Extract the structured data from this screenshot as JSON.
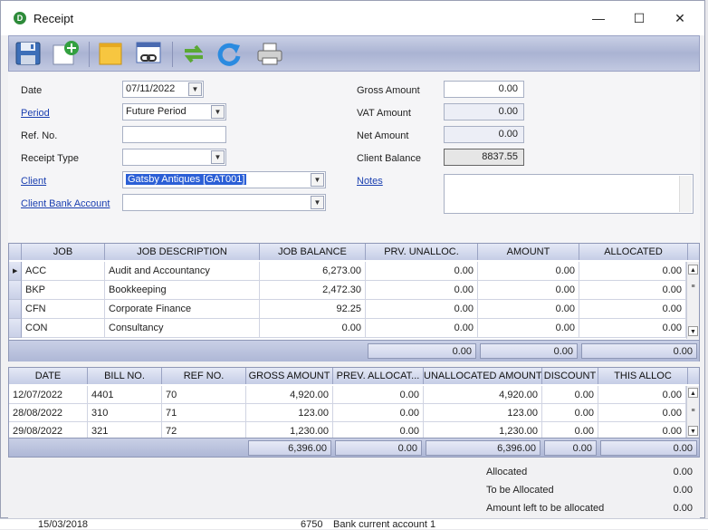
{
  "window": {
    "title": "Receipt",
    "minimize": "—",
    "maximize": "☐",
    "close": "✕"
  },
  "toolbar": {
    "icons": [
      "save-icon",
      "new-icon",
      "note-icon",
      "link-icon",
      "refresh-icon",
      "redo-icon",
      "print-icon"
    ]
  },
  "form": {
    "date_label": "Date",
    "date_value": "07/11/2022",
    "period_label": "Period",
    "period_value": "Future Period",
    "ref_label": "Ref. No.",
    "ref_value": "",
    "receipt_type_label": "Receipt Type",
    "receipt_type_value": "",
    "client_label": "Client",
    "client_value": "Gatsby Antiques [GAT001]",
    "client_bank_label": "Client Bank Account",
    "client_bank_value": "",
    "gross_label": "Gross Amount",
    "gross_value": "0.00",
    "vat_label": "VAT Amount",
    "vat_value": "0.00",
    "net_label": "Net Amount",
    "net_value": "0.00",
    "balance_label": "Client Balance",
    "balance_value": "8837.55",
    "notes_label": "Notes",
    "notes_value": ""
  },
  "jobs": {
    "headers": [
      "JOB",
      "JOB DESCRIPTION",
      "JOB BALANCE",
      "PRV. UNALLOC.",
      "AMOUNT",
      "ALLOCATED"
    ],
    "rows": [
      [
        "ACC",
        "Audit and Accountancy",
        "6,273.00",
        "0.00",
        "0.00",
        "0.00"
      ],
      [
        "BKP",
        "Bookkeeping",
        "2,472.30",
        "0.00",
        "0.00",
        "0.00"
      ],
      [
        "CFN",
        "Corporate Finance",
        "92.25",
        "0.00",
        "0.00",
        "0.00"
      ],
      [
        "CON",
        "Consultancy",
        "0.00",
        "0.00",
        "0.00",
        "0.00"
      ]
    ],
    "footer": [
      "0.00",
      "0.00",
      "0.00"
    ]
  },
  "bills": {
    "headers": [
      "DATE",
      "BILL NO.",
      "REF NO.",
      "GROSS AMOUNT",
      "PREV. ALLOCAT...",
      "UNALLOCATED AMOUNT",
      "DISCOUNT",
      "THIS ALLOC"
    ],
    "rows": [
      [
        "12/07/2022",
        "4401",
        "70",
        "4,920.00",
        "0.00",
        "4,920.00",
        "0.00",
        "0.00"
      ],
      [
        "28/08/2022",
        "310",
        "71",
        "123.00",
        "0.00",
        "123.00",
        "0.00",
        "0.00"
      ],
      [
        "29/08/2022",
        "321",
        "72",
        "1,230.00",
        "0.00",
        "1,230.00",
        "0.00",
        "0.00"
      ]
    ],
    "footer": [
      "6,396.00",
      "0.00",
      "6,396.00",
      "0.00",
      "0.00"
    ]
  },
  "summary": {
    "allocated_label": "Allocated",
    "allocated_value": "0.00",
    "to_be_label": "To be Allocated",
    "to_be_value": "0.00",
    "left_label": "Amount left to be allocated",
    "left_value": "0.00"
  },
  "background_row": {
    "date": "15/03/2018",
    "code": "6750",
    "desc": "Bank current account 1"
  }
}
